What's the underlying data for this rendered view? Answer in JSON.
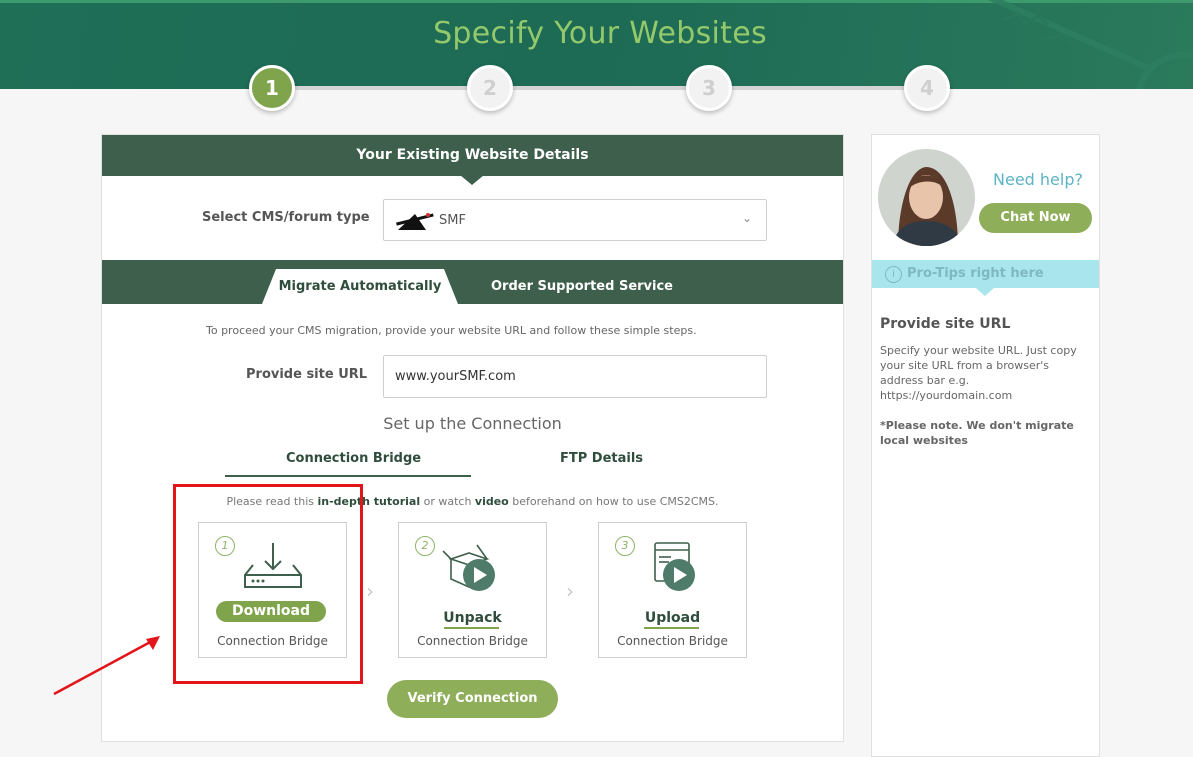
{
  "header": {
    "title": "Specify Your Websites"
  },
  "steps": [
    "1",
    "2",
    "3",
    "4"
  ],
  "card": {
    "title": "Your Existing Website Details",
    "cms_label": "Select CMS/forum type",
    "cms_value": "SMF",
    "tabs": {
      "auto": "Migrate Automatically",
      "order": "Order Supported Service"
    },
    "hint": "To proceed your CMS migration, provide your website URL and follow these simple steps.",
    "url_label": "Provide site URL",
    "url_value": "www.yourSMF.com",
    "setup_title": "Set up the Connection",
    "subtabs": {
      "bridge": "Connection Bridge",
      "ftp": "FTP Details"
    },
    "read_hint": {
      "pre": "Please read this ",
      "tutorial": "in-depth tutorial",
      "mid": " or watch ",
      "video": "video",
      "post": " beforehand on how to use CMS2CMS."
    },
    "bridge_steps": [
      {
        "num": "1",
        "action": "Download",
        "sub": "Connection Bridge"
      },
      {
        "num": "2",
        "action": "Unpack",
        "sub": "Connection Bridge"
      },
      {
        "num": "3",
        "action": "Upload",
        "sub": "Connection Bridge"
      }
    ],
    "verify_label": "Verify Connection"
  },
  "sidebar": {
    "need_help": "Need help?",
    "chat_label": "Chat Now",
    "protips": "Pro-Tips right here",
    "heading": "Provide site URL",
    "body": "Specify your website URL. Just copy your site URL from a browser's address bar e.g. https://yourdomain.com",
    "note": "*Please note. We don't migrate local websites"
  },
  "colors": {
    "brand_green": "#3e5f4c",
    "accent_green": "#8fae5a",
    "highlight_red": "#e3151a",
    "help_blue": "#5cb3c2"
  }
}
